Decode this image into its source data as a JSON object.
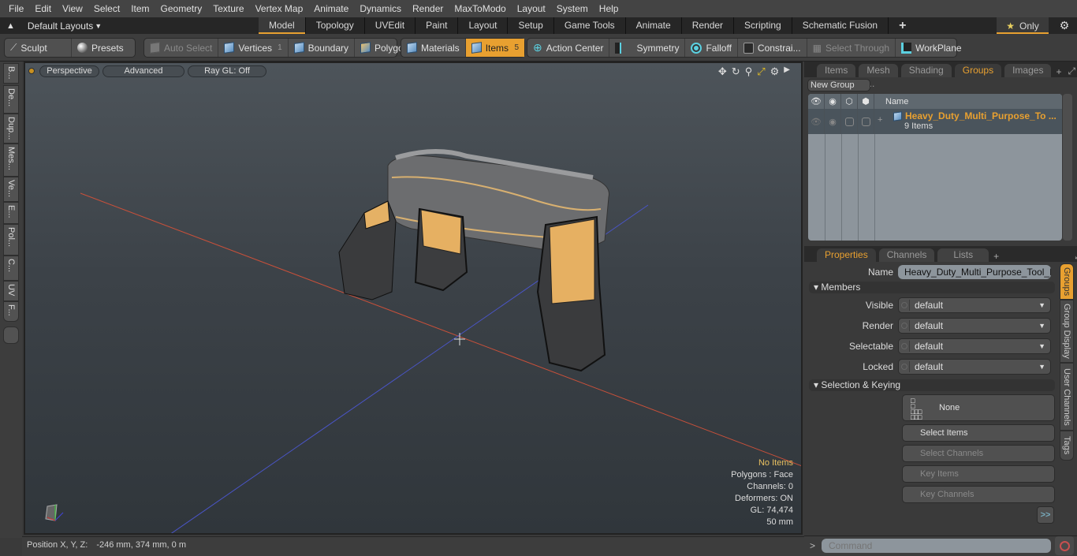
{
  "menu": [
    "File",
    "Edit",
    "View",
    "Select",
    "Item",
    "Geometry",
    "Texture",
    "Vertex Map",
    "Animate",
    "Dynamics",
    "Render",
    "MaxToModo",
    "Layout",
    "System",
    "Help"
  ],
  "layout_selector": "Default Layouts",
  "layout_tabs": [
    "Model",
    "Topology",
    "UVEdit",
    "Paint",
    "Layout",
    "Setup",
    "Game Tools",
    "Animate",
    "Render",
    "Scripting",
    "Schematic Fusion"
  ],
  "active_layout_tab": "Model",
  "only_label": "Only",
  "toolbar": {
    "sculpt": "Sculpt",
    "presets": "Presets",
    "auto_select": "Auto Select",
    "vertices": "Vertices",
    "vertices_count": "1",
    "boundary": "Boundary",
    "polygons": "Polygons",
    "materials": "Materials",
    "items": "Items",
    "items_count": "5",
    "action_center": "Action Center",
    "symmetry": "Symmetry",
    "falloff": "Falloff",
    "constraints": "Constrai...",
    "select_through": "Select Through",
    "workplane": "WorkPlane"
  },
  "left_tabs": [
    "B...",
    "De...",
    "Dup...",
    "Mes...",
    "Ve...",
    "E...",
    "Pol...",
    "C...",
    "UV",
    "F..."
  ],
  "viewport": {
    "perspective": "Perspective",
    "advanced": "Advanced",
    "raygl": "Ray GL: Off",
    "info": {
      "items": "No Items",
      "polygons": "Polygons : Face",
      "channels": "Channels: 0",
      "deformers": "Deformers: ON",
      "gl": "GL: 74,474",
      "scale": "50 mm"
    }
  },
  "status": {
    "label": "Position X, Y, Z:",
    "value": "-246 mm, 374 mm, 0 m"
  },
  "groups_panel": {
    "tabs": [
      "Items",
      "Mesh ...",
      "Shading",
      "Groups",
      "Images"
    ],
    "active_tab": "Groups",
    "new_group": "New Group",
    "col_name": "Name",
    "group_name": "Heavy_Duty_Multi_Purpose_To ...",
    "group_count": "9 Items"
  },
  "properties_panel": {
    "tabs": [
      "Properties",
      "Channels",
      "Lists"
    ],
    "active_tab": "Properties",
    "name_label": "Name",
    "name_value": "Heavy_Duty_Multi_Purpose_Tool_Belt",
    "members_section": "Members",
    "fields": [
      {
        "label": "Visible",
        "value": "default"
      },
      {
        "label": "Render",
        "value": "default"
      },
      {
        "label": "Selectable",
        "value": "default"
      },
      {
        "label": "Locked",
        "value": "default"
      }
    ],
    "selection_section": "Selection & Keying",
    "none_label": "None",
    "select_items": "Select Items",
    "select_channels": "Select Channels",
    "key_items": "Key Items",
    "key_channels": "Key Channels",
    "more": ">>",
    "side_tabs": [
      "Groups",
      "Group Display",
      "User Channels",
      "Tags"
    ]
  },
  "command": {
    "placeholder": "Command"
  },
  "colors": {
    "accent": "#e8a030",
    "x_axis": "#d0503a",
    "z_axis": "#4a5ad0"
  }
}
